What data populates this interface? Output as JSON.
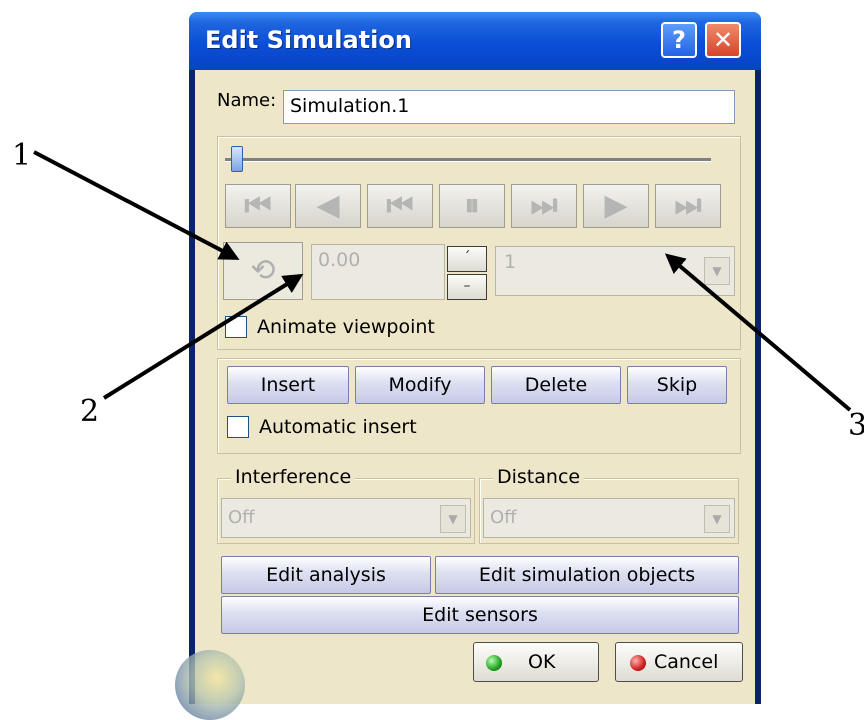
{
  "window": {
    "title": "Edit Simulation",
    "help_glyph": "?",
    "close_glyph": "✕"
  },
  "name": {
    "label": "Name:",
    "value": "Simulation.1"
  },
  "player": {
    "slider_position": 0.0,
    "buttons": [
      "jump-to-start",
      "step-backward",
      "skip-to-start",
      "pause",
      "skip-to-end",
      "play",
      "jump-to-end"
    ],
    "loop_icon": "loop-icon",
    "step_value": "0.00",
    "spin_up_glyph": "ˊ",
    "spin_down_glyph": "–",
    "speed_value": "1",
    "animate_viewpoint_label": "Animate viewpoint",
    "animate_viewpoint_checked": false
  },
  "edit": {
    "insert_label": "Insert",
    "modify_label": "Modify",
    "delete_label": "Delete",
    "skip_label": "Skip",
    "automatic_insert_label": "Automatic insert",
    "automatic_insert_checked": false
  },
  "analysis": {
    "interference_label": "Interference",
    "interference_value": "Off",
    "distance_label": "Distance",
    "distance_value": "Off"
  },
  "actions": {
    "edit_analysis_label": "Edit analysis",
    "edit_sim_objects_label": "Edit simulation objects",
    "edit_sensors_label": "Edit sensors"
  },
  "footer": {
    "ok_label": "OK",
    "cancel_label": "Cancel"
  },
  "callouts": {
    "c1": "1",
    "c2": "2",
    "c3": "3"
  },
  "colors": {
    "title_bar": "#0a4fd6",
    "client_bg": "#ede6c8",
    "ok_dot": "#22a022",
    "cancel_dot": "#d02020"
  }
}
